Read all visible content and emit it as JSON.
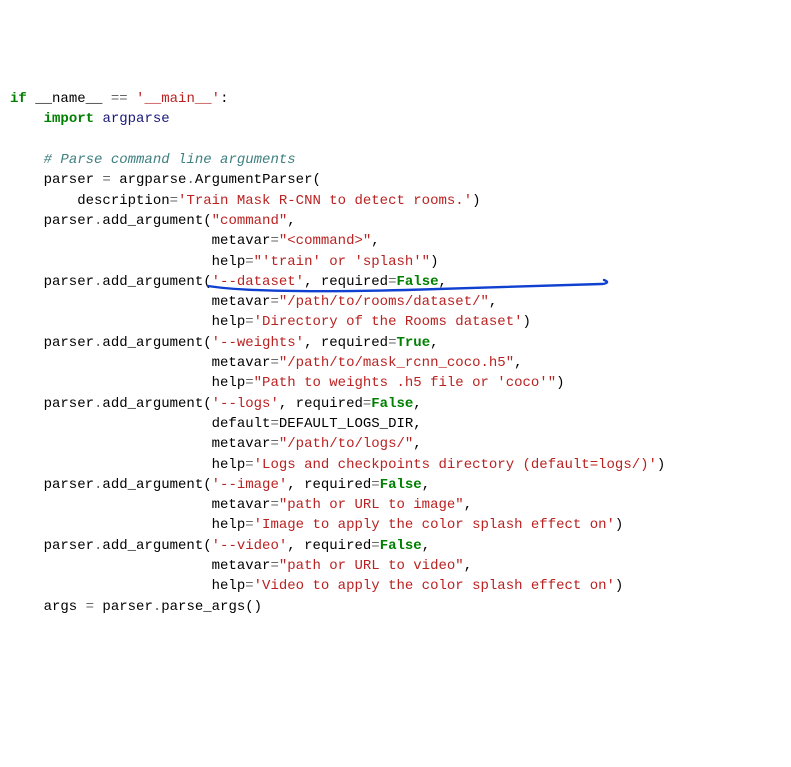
{
  "line1": {
    "t1": "if",
    "t2": " __name__ ",
    "t3": "==",
    "t4": " ",
    "t5": "'__main__'",
    "t6": ":"
  },
  "line2": {
    "t1": "    ",
    "t2": "import",
    "t3": " ",
    "t4": "argparse"
  },
  "line3": {
    "t1": ""
  },
  "line4": {
    "t1": "    ",
    "t2": "# Parse command line arguments"
  },
  "line5": {
    "t1": "    parser ",
    "t2": "=",
    "t3": " argparse",
    "t4": ".",
    "t5": "ArgumentParser("
  },
  "line6": {
    "t1": "        description",
    "t2": "=",
    "t3": "'Train Mask R-CNN to detect rooms.'",
    "t4": ")"
  },
  "line7": {
    "t1": "    parser",
    "t2": ".",
    "t3": "add_argument(",
    "t4": "\"command\"",
    "t5": ","
  },
  "line8": {
    "t1": "                        metavar",
    "t2": "=",
    "t3": "\"<command>\"",
    "t4": ","
  },
  "line9": {
    "t1": "                        help",
    "t2": "=",
    "t3": "\"'train' or 'splash'\"",
    "t4": ")"
  },
  "line10": {
    "t1": "    parser",
    "t2": ".",
    "t3": "add_argument(",
    "t4": "'--dataset'",
    "t5": ", required",
    "t6": "=",
    "t7": "False",
    "t8": ","
  },
  "line11": {
    "t1": "                        metavar",
    "t2": "=",
    "t3": "\"/path/to/rooms/dataset/\"",
    "t4": ","
  },
  "line12": {
    "t1": "                        help",
    "t2": "=",
    "t3": "'Directory of the Rooms dataset'",
    "t4": ")"
  },
  "line13": {
    "t1": "    parser",
    "t2": ".",
    "t3": "add_argument(",
    "t4": "'--weights'",
    "t5": ", required",
    "t6": "=",
    "t7": "True",
    "t8": ","
  },
  "line14": {
    "t1": "                        metavar",
    "t2": "=",
    "t3": "\"/path/to/mask_rcnn_coco.h5\"",
    "t4": ","
  },
  "line15": {
    "t1": "                        help",
    "t2": "=",
    "t3": "\"Path to weights .h5 file or 'coco'\"",
    "t4": ")"
  },
  "line16": {
    "t1": "    parser",
    "t2": ".",
    "t3": "add_argument(",
    "t4": "'--logs'",
    "t5": ", required",
    "t6": "=",
    "t7": "False",
    "t8": ","
  },
  "line17": {
    "t1": "                        default",
    "t2": "=",
    "t3": "DEFAULT_LOGS_DIR,"
  },
  "line18": {
    "t1": "                        metavar",
    "t2": "=",
    "t3": "\"/path/to/logs/\"",
    "t4": ","
  },
  "line19": {
    "t1": "                        help",
    "t2": "=",
    "t3": "'Logs and checkpoints directory (default=logs/)'",
    "t4": ")"
  },
  "line20": {
    "t1": "    parser",
    "t2": ".",
    "t3": "add_argument(",
    "t4": "'--image'",
    "t5": ", required",
    "t6": "=",
    "t7": "False",
    "t8": ","
  },
  "line21": {
    "t1": "                        metavar",
    "t2": "=",
    "t3": "\"path or URL to image\"",
    "t4": ","
  },
  "line22": {
    "t1": "                        help",
    "t2": "=",
    "t3": "'Image to apply the color splash effect on'",
    "t4": ")"
  },
  "line23": {
    "t1": "    parser",
    "t2": ".",
    "t3": "add_argument(",
    "t4": "'--video'",
    "t5": ", required",
    "t6": "=",
    "t7": "False",
    "t8": ","
  },
  "line24": {
    "t1": "                        metavar",
    "t2": "=",
    "t3": "\"path or URL to video\"",
    "t4": ","
  },
  "line25": {
    "t1": "                        help",
    "t2": "=",
    "t3": "'Video to apply the color splash effect on'",
    "t4": ")"
  },
  "line26": {
    "t1": "    args ",
    "t2": "=",
    "t3": " parser",
    "t4": ".",
    "t5": "parse_args()"
  }
}
